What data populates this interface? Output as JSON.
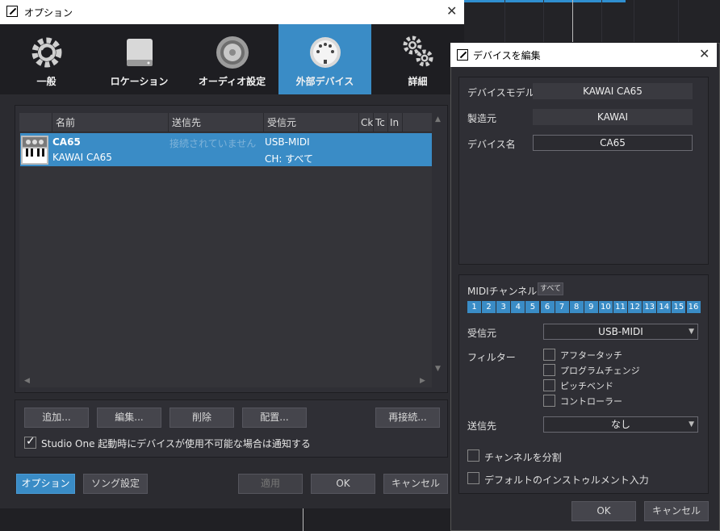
{
  "options_window": {
    "title": "オプション",
    "tabs": [
      {
        "label": "一般",
        "icon": "gear-icon"
      },
      {
        "label": "ロケーション",
        "icon": "drive-icon"
      },
      {
        "label": "オーディオ設定",
        "icon": "speaker-icon"
      },
      {
        "label": "外部デバイス",
        "icon": "midi-port-icon",
        "active": true
      },
      {
        "label": "詳細",
        "icon": "gears-icon"
      }
    ],
    "table": {
      "headers": [
        "名前",
        "送信先",
        "受信元",
        "Ck",
        "Tc",
        "In"
      ],
      "rows": [
        {
          "name": "CA65",
          "manufacturer_model": "KAWAI CA65",
          "send_to": "接続されていません",
          "receive_from": "USB-MIDI",
          "channel": "CH: すべて",
          "icon": "keyboard-icon"
        }
      ]
    },
    "buttons": {
      "add": "追加...",
      "edit": "編集...",
      "delete": "削除",
      "placement": "配置...",
      "reconnect": "再接続..."
    },
    "notify_checkbox": {
      "label": "Studio One 起動時にデバイスが使用不可能な場合は通知する",
      "checked": true
    },
    "footer": {
      "options": "オプション",
      "song_settings": "ソング設定",
      "apply": "適用",
      "ok": "OK",
      "cancel": "キャンセル"
    }
  },
  "device_window": {
    "title": "デバイスを編集",
    "fields": {
      "model_label": "デバイスモデル",
      "model_value": "KAWAI CA65",
      "manufacturer_label": "製造元",
      "manufacturer_value": "KAWAI",
      "name_label": "デバイス名",
      "name_value": "CA65"
    },
    "midi": {
      "channel_label": "MIDIチャンネル",
      "all_button": "すべて",
      "channels": [
        "1",
        "2",
        "3",
        "4",
        "5",
        "6",
        "7",
        "8",
        "9",
        "10",
        "11",
        "12",
        "13",
        "14",
        "15",
        "16"
      ],
      "receive_label": "受信元",
      "receive_value": "USB-MIDI",
      "filter_label": "フィルター",
      "filters": [
        {
          "label": "アフタータッチ",
          "checked": false
        },
        {
          "label": "プログラムチェンジ",
          "checked": false
        },
        {
          "label": "ピッチベンド",
          "checked": false
        },
        {
          "label": "コントローラー",
          "checked": false
        }
      ],
      "send_label": "送信先",
      "send_value": "なし",
      "split_channels": {
        "label": "チャンネルを分割",
        "checked": false
      },
      "default_instrument_input": {
        "label": "デフォルトのインストゥルメント入力",
        "checked": false
      }
    },
    "footer": {
      "ok": "OK",
      "cancel": "キャンセル"
    }
  },
  "colors": {
    "accent": "#3a8cc6",
    "panel": "#2f2f35",
    "background": "#2b2b30"
  }
}
